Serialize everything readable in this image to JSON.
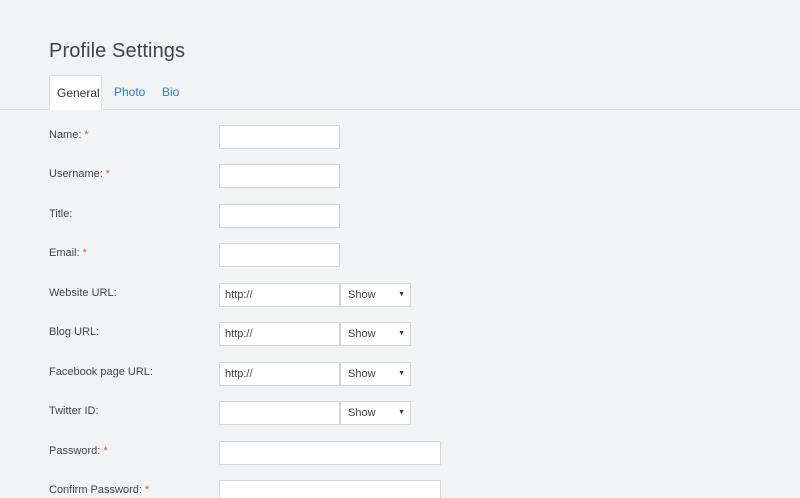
{
  "page": {
    "title": "Profile Settings"
  },
  "tabs": [
    {
      "label": "General",
      "active": true
    },
    {
      "label": "Photo",
      "active": false
    },
    {
      "label": "Bio",
      "active": false
    }
  ],
  "form": {
    "required_marker": "*",
    "fields": [
      {
        "label": "Name:",
        "required": true,
        "value": ""
      },
      {
        "label": "Username:",
        "required": true,
        "value": ""
      },
      {
        "label": "Title:",
        "required": false,
        "value": ""
      },
      {
        "label": "Email:",
        "required": true,
        "value": ""
      },
      {
        "label": "Website URL:",
        "required": false,
        "value": "http://",
        "visibility": "Show"
      },
      {
        "label": "Blog URL:",
        "required": false,
        "value": "http://",
        "visibility": "Show"
      },
      {
        "label": "Facebook page URL:",
        "required": false,
        "value": "http://",
        "visibility": "Show"
      },
      {
        "label": "Twitter ID:",
        "required": false,
        "value": "",
        "visibility": "Show"
      },
      {
        "label": "Password:",
        "required": true,
        "value": ""
      },
      {
        "label": "Confirm Password:",
        "required": true,
        "value": ""
      }
    ]
  },
  "colors": {
    "background": "#f2f3f5",
    "link": "#2d7fc4",
    "required": "#d9534f"
  },
  "icons": {
    "dropdown": "caret-down-icon"
  }
}
